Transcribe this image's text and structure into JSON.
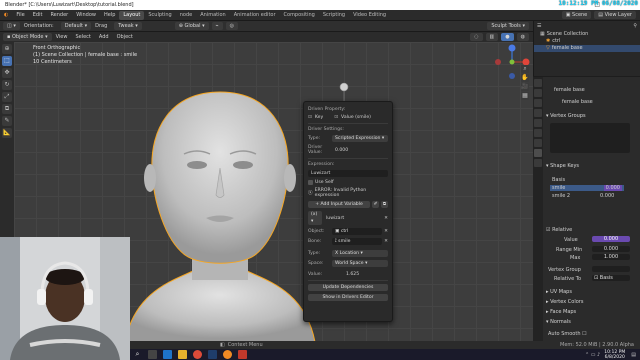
{
  "window": {
    "title": "Blender* [C:\\Users\\Luwizart\\Desktop\\tutorial.blend]",
    "clock_overlay": "10:12:19 PM 06/08/2020"
  },
  "menubar": {
    "menus": [
      "File",
      "Edit",
      "Render",
      "Window",
      "Help"
    ],
    "workspace_tabs": [
      "Layout",
      "Sculpting",
      "node",
      "Animation",
      "Animation editor",
      "Compositing",
      "Scripting",
      "Video Editing"
    ],
    "active_tab": "Layout",
    "scene_label": "Scene",
    "view_layer_label": "View Layer"
  },
  "header": {
    "orientation_label": "Orientation:",
    "orientation_value": "Default",
    "drag_label": "Drag",
    "drag_value": "Tweak",
    "transform_space": "Global",
    "sculpt_tools": "Sculpt Tools"
  },
  "header2": {
    "mode": "Object Mode",
    "menus": [
      "View",
      "Select",
      "Add",
      "Object"
    ]
  },
  "viewport": {
    "info_lines": [
      "Front Orthographic",
      "(1) Scene Collection | female base : smile",
      "10 Centimeters"
    ]
  },
  "driver_popup": {
    "title": "Driven Property:",
    "driven_key": "Key",
    "driven_value": "Value (smile)",
    "settings_title": "Driver Settings:",
    "type_label": "Type:",
    "type_value": "Scripted Expression",
    "driver_value_label": "Driver Value:",
    "driver_value": "0.000",
    "expression_label": "Expression:",
    "expression_value": "Luwizart",
    "use_self": "Use Self",
    "error": "ERROR: Invalid Python expression",
    "add_variable": "Add Input Variable",
    "var_name": "luwizart",
    "object_label": "Object:",
    "object_value": "ctrl",
    "bone_label": "Bone:",
    "bone_value": "smile",
    "type2_label": "Type:",
    "type2_value": "X Location",
    "space_label": "Space:",
    "space_value": "World Space",
    "value_label": "Value:",
    "value_value": "1.625",
    "update_deps": "Update Dependencies",
    "show_in_drivers": "Show in Drivers Editor"
  },
  "outliner": {
    "root": "Scene Collection",
    "items": [
      "ctrl",
      "female base"
    ]
  },
  "properties": {
    "object_name": "female base",
    "mesh_name": "female base",
    "vertex_groups": "Vertex Groups",
    "shape_keys": "Shape Keys",
    "keys": [
      {
        "name": "Basis",
        "value": ""
      },
      {
        "name": "smile",
        "value": "0.000"
      },
      {
        "name": "smile 2",
        "value": "0.000"
      }
    ],
    "relative": "Relative",
    "value_label": "Value",
    "value": "0.000",
    "range_min_label": "Range Min",
    "range_min": "0.000",
    "max_label": "Max",
    "max": "1.000",
    "vertex_group_label": "Vertex Group",
    "relative_to_label": "Relative To",
    "relative_to": "Basis",
    "sections": [
      "UV Maps",
      "Vertex Colors",
      "Face Maps",
      "Normals"
    ],
    "auto_smooth": "Auto Smooth"
  },
  "statusbar": {
    "left": "Context Menu",
    "right": "Mem: 52.0 MiB | 2.90.0 Alpha"
  },
  "taskbar": {
    "time": "10:12 PM",
    "date": "6/8/2020"
  },
  "colors": {
    "accent_blue": "#4772b3",
    "selection_orange": "#f5a623",
    "clock_cyan": "#1fd8ff"
  }
}
